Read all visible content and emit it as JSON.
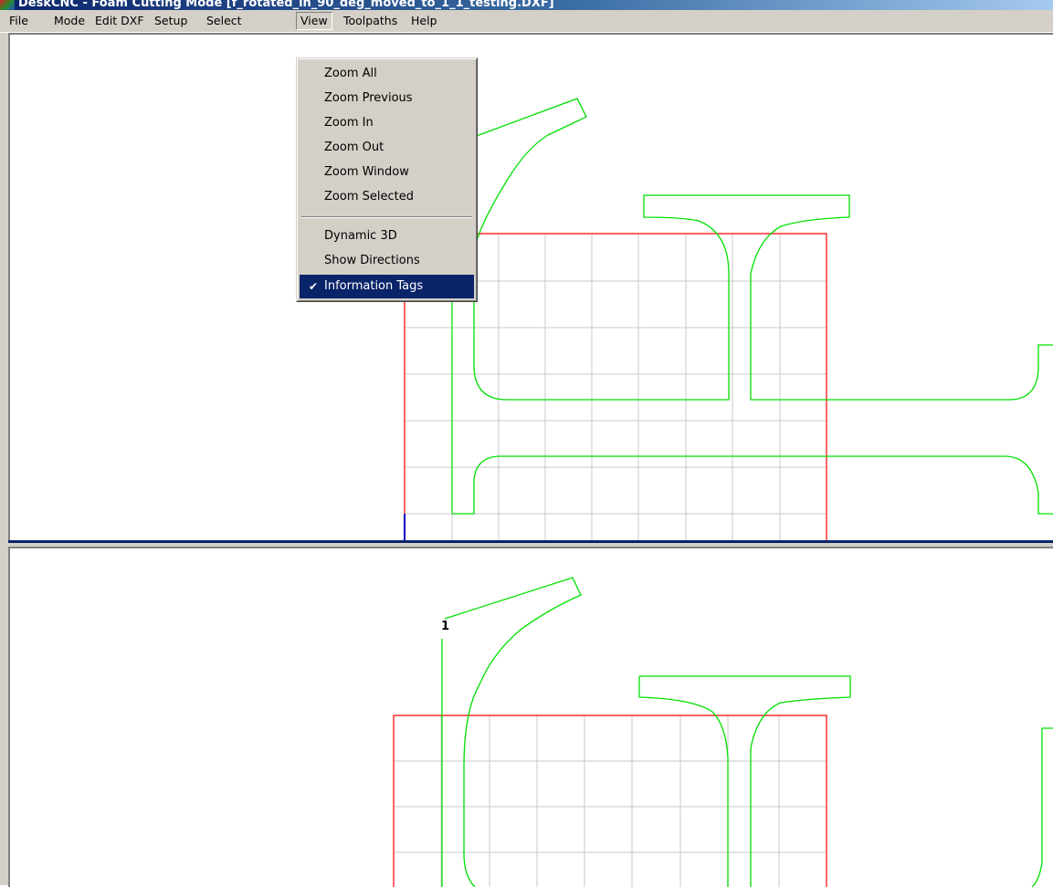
{
  "window": {
    "title": "DeskCNC - Foam Cutting Mode [f_rotated_in_90_deg_moved_to_1_1_testing.DXF]"
  },
  "menubar": {
    "items": [
      "File",
      "Mode",
      "Edit DXF",
      "Setup",
      "Select",
      "View",
      "Toolpaths",
      "Help"
    ],
    "open_item": "View"
  },
  "view_menu": {
    "items": [
      "Zoom All",
      "Zoom Previous",
      "Zoom In",
      "Zoom Out",
      "Zoom Window",
      "Zoom Selected",
      "Dynamic 3D",
      "Show Directions",
      "Information Tags"
    ],
    "checked": "Information Tags",
    "highlighted": "Information Tags",
    "check_icon": "check-icon"
  },
  "bottom_pane": {
    "info_tag": "1"
  },
  "colors": {
    "stock_outline": "#ff0000",
    "grid": "#c8c8c8",
    "toolpath": "#00e000",
    "splitter": "#0a246a",
    "menu_bg": "#d4d0c8",
    "highlight": "#0a246a"
  }
}
